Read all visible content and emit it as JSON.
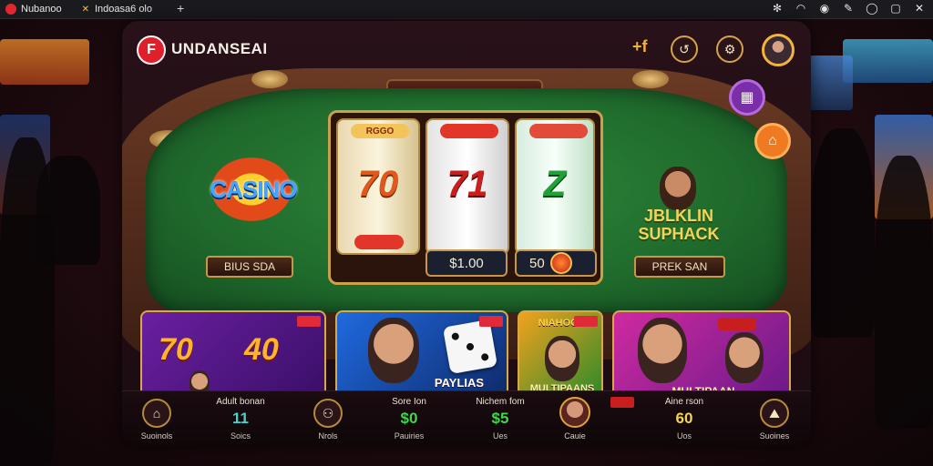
{
  "browser": {
    "tabs": [
      {
        "label": "Nubanoo",
        "close": "✕"
      },
      {
        "label": "Indoasa6 olo",
        "close": ""
      }
    ],
    "new_tab": "+",
    "sys_icons": [
      "settings-icon",
      "wifi-icon",
      "location-icon",
      "pen-icon",
      "chat-icon",
      "window-icon",
      "close-icon"
    ]
  },
  "app": {
    "brand": "UNDANSEAI",
    "logo_glyph": "F",
    "header_symbol": "+f",
    "header_buttons": [
      "↺",
      "⚙"
    ],
    "casino_logo": "CASINO",
    "left_label": "BIUS SDA",
    "right_label": "PREK SAN",
    "promo": {
      "line1": "JBLKLIN",
      "line2": "SUPHACK"
    },
    "reels": [
      {
        "top": "RGGO",
        "symbol": "70"
      },
      {
        "top": "",
        "symbol": "71"
      },
      {
        "top": "",
        "symbol": "Z"
      }
    ],
    "bet_amount": "$1.00",
    "win_amount": "50",
    "cards": [
      {
        "n1": "70",
        "n2": "40",
        "badge": ""
      },
      {
        "text": "PAYLIAS PLIANES",
        "badge": ""
      },
      {
        "top": "NIAHOOG",
        "text": "MULTIPAANS",
        "badge": ""
      },
      {
        "top": "",
        "text": "MULTIPAAN",
        "badge": ""
      }
    ],
    "bottom": {
      "home_label": "Suoinols",
      "stat1": {
        "label": "Adult bonan",
        "value": "11",
        "sub": "Soics"
      },
      "play_label": "Nrols",
      "stat2": {
        "label": "Sore Ion",
        "value": "$0",
        "sub": "Pauiries"
      },
      "stat3": {
        "label": "Nichem fom",
        "value": "$5",
        "sub": "Ues"
      },
      "avatar_label": "Cauie",
      "stat4": {
        "label": "Aine rson",
        "value": "60",
        "sub": "Uos"
      },
      "last_label": "Suoines"
    }
  },
  "colors": {
    "accent_gold": "#d6a24a",
    "felt_green": "#2f8a3a",
    "brand_red": "#e01f2a"
  }
}
